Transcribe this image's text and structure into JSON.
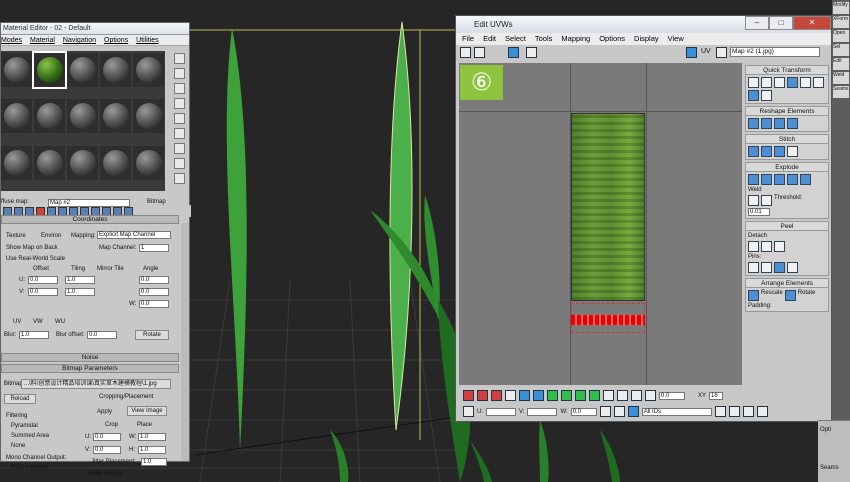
{
  "material_editor": {
    "title": "Material Editor - 02 - Default",
    "menu": [
      "Modes",
      "Material",
      "Navigation",
      "Options",
      "Utilities"
    ],
    "slot_count": 15,
    "selected_slot": 1,
    "map_label": "ffuse map:",
    "map_value": "Map #2",
    "map_type": "Bitmap",
    "coordinates": {
      "header": "Coordinates",
      "texture_label": "Texture",
      "environ_label": "Environ",
      "mapping_label": "Mapping:",
      "mapping_value": "Explicit Map Channel",
      "show_map_label": "Show Map on Back",
      "map_channel_label": "Map Channel:",
      "map_channel_value": "1",
      "real_world_label": "Use Real-World Scale",
      "offset_label": "Offset",
      "tiling_label": "Tiling",
      "mirror_tile_label": "Mirror Tile",
      "angle_label": "Angle",
      "u_label": "U:",
      "v_label": "V:",
      "w_label": "W:",
      "offset_u": "0.0",
      "offset_v": "0.0",
      "tiling_u": "1.0",
      "tiling_v": "1.0",
      "angle_u": "0.0",
      "angle_v": "0.0",
      "angle_w": "0.0",
      "uv_label": "UV",
      "vw_label": "VW",
      "wu_label": "WU",
      "blur_label": "Blur:",
      "blur_value": "1.0",
      "blur_offset_label": "Blur offset:",
      "blur_offset_value": "0.0",
      "rotate_label": "Rotate"
    },
    "noise_header": "Noise",
    "bitmap_params": {
      "header": "Bitmap Parameters",
      "bitmap_label": "Bitmap:",
      "bitmap_path": "...\\料\\创意设计精品培训课\\真实草木建模教程\\1.jpg",
      "reload_label": "Reload",
      "cropping_label": "Cropping/Placement",
      "apply_label": "Apply",
      "view_image_label": "View Image",
      "crop_label": "Crop",
      "place_label": "Place",
      "filtering_label": "Filtering",
      "pyramidal_label": "Pyramidal",
      "summed_area_label": "Summed Area",
      "none_label": "None",
      "u_value": "0.0",
      "w_value": "1.0",
      "v_value": "0.0",
      "h_value": "1.0",
      "u_label": "U:",
      "w_label": "W:",
      "v_label": "V:",
      "h_label": "H:",
      "jitter_label": "Jitter Placement:",
      "jitter_value": "1.0",
      "mono_label": "Mono Channel Output:",
      "rgb_intensity_label": "RGB Intensity",
      "alpha_source_label": "Alpha Source"
    }
  },
  "uvw_editor": {
    "title": "Edit UVWs",
    "menu": [
      "File",
      "Edit",
      "Select",
      "Tools",
      "Mapping",
      "Options",
      "Display",
      "View"
    ],
    "uv_label": "UV",
    "map_dropdown": "Map #2 (1.jpg)",
    "step_badge": "⑥",
    "panels": {
      "quick_transform": "Quick Transform",
      "reshape_elements": "Reshape Elements",
      "stitch": "Stitch",
      "explode": "Explode",
      "weld_label": "Weld",
      "threshold_label": "Threshold:",
      "threshold_value": "0.01",
      "peel": "Peel",
      "detach_label": "Detach",
      "pins_label": "Pins:",
      "arrange_elements": "Arrange Elements",
      "rescale_label": "Rescale",
      "rotate_label": "Rotate",
      "padding_label": "Padding:"
    },
    "bottom": {
      "value_1": "0.0",
      "u_label": "U:",
      "v_label": "V:",
      "w_label": "W:",
      "u_value": "",
      "v_value": "",
      "w_value": "0.0",
      "ids_dropdown": "All IDs",
      "xy_label": "XY",
      "zoom_value": "16"
    }
  },
  "right_strip": [
    "Modify",
    "XForm",
    "Open",
    "Sel",
    "Edit",
    "Weld",
    "Seams"
  ],
  "command_panel": {
    "label_1": "Opti",
    "label_2": "Seams"
  }
}
